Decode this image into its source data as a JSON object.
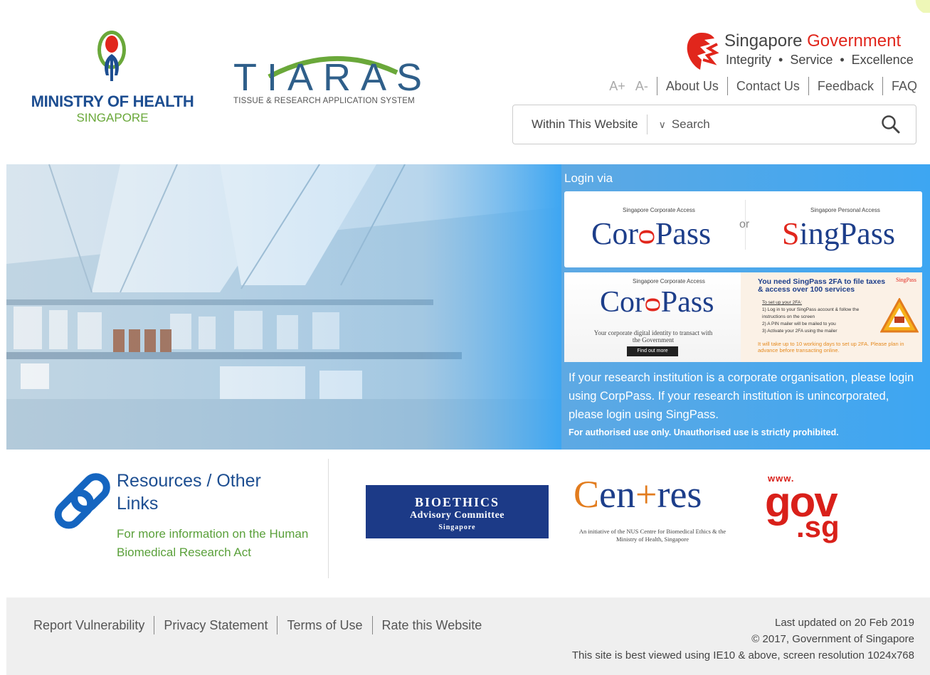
{
  "header": {
    "moh": {
      "title": "MINISTRY OF HEALTH",
      "subtitle": "SINGAPORE"
    },
    "tiaras": {
      "name": "TIARAS",
      "subtitle": "TISSUE & RESEARCH APPLICATION SYSTEM"
    },
    "gov": {
      "title_a": "Singapore ",
      "title_b": "Government",
      "tagline": "Integrity  •  Service  •  Excellence"
    },
    "utility": {
      "font_up": "A+",
      "font_down": "A-",
      "about": "About Us",
      "contact": "Contact Us",
      "feedback": "Feedback",
      "faq": "FAQ"
    },
    "search": {
      "scope": "Within This Website",
      "placeholder": "Search",
      "icon": "search-icon"
    }
  },
  "banner": {
    "login_label": "Login via",
    "corppass": {
      "caption": "Singapore Corporate Access",
      "word_a": "Cor",
      "word_b": "Pass"
    },
    "or": "or",
    "singpass": {
      "caption": "Singapore Personal Access",
      "word_a": "S",
      "word_b": "ingPass"
    },
    "ad_corp": {
      "caption": "Singapore Corporate Access",
      "word_a": "Cor",
      "word_b": "Pass",
      "tagline": "Your corporate digital identity to transact with the Government",
      "button": "Find out more"
    },
    "ad_sing": {
      "title": "You need SingPass 2FA to file taxes & access over 100 services",
      "logo": "SingPass",
      "steps": [
        "To set up your 2FA:",
        "1) Log in to your SingPass account & follow the instructions on the screen",
        "2) A PIN mailer will be mailed to you",
        "3) Activate your 2FA using the mailer"
      ],
      "warning": "It will take up to 10 working days to set up 2FA. Please plan in advance before transacting online."
    },
    "note": "If your research institution is a corporate organisation, please login using CorpPass. If your research institution is unincorporated, please login using SingPass.",
    "warning": "For authorised use only. Unauthorised use is strictly prohibited."
  },
  "resources": {
    "title": "Resources / Other Links",
    "desc": "For more information on the Human Biomedical Research Act",
    "bac": {
      "line1": "BIOETHICS",
      "line2": "Advisory Committee",
      "line3": "Singapore"
    },
    "centres": {
      "word_a": "C",
      "word_b": "en",
      "word_c": "+",
      "word_d": "res",
      "sub": "An initiative of the NUS Centre for Biomedical Ethics & the Ministry of Health, Singapore"
    },
    "govsg": {
      "www": "www.",
      "gov": "gov",
      "sg": ".sg"
    }
  },
  "footer": {
    "links": [
      "Report Vulnerability",
      "Privacy Statement",
      "Terms of Use",
      "Rate this Website"
    ],
    "updated": "Last updated on 20 Feb 2019",
    "copyright": "© 2017, Government of Singapore",
    "browser": "This site is best viewed using IE10 & above, screen resolution 1024x768"
  },
  "colors": {
    "brand_blue": "#1d4e91",
    "brand_green": "#6aa83a",
    "gov_red": "#e1261c",
    "banner_blue": "#3da6f2"
  }
}
